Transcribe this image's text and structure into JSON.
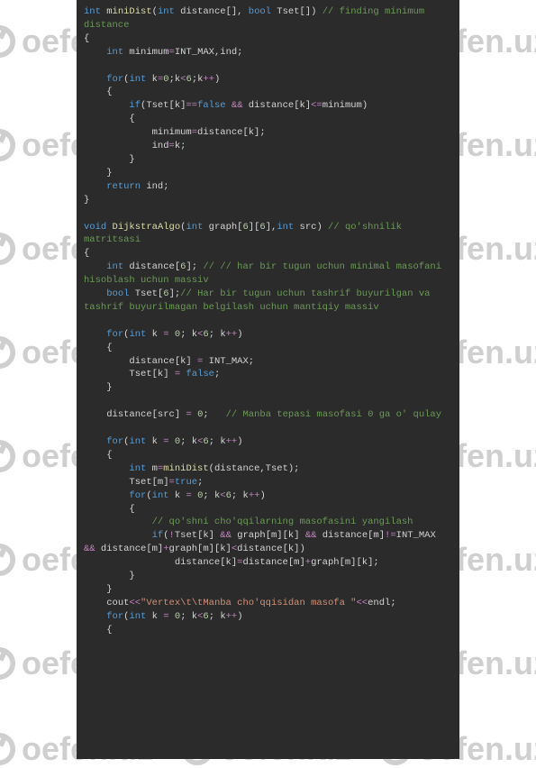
{
  "watermark": {
    "text": "oefen.uz"
  },
  "code": {
    "l01a": "int",
    "l01b": "miniDist",
    "l01c": "int",
    "l01d": " distance[], ",
    "l01e": "bool",
    "l01f": " Tset[]) ",
    "l01g": "// finding minimum distance",
    "l02": "{",
    "l03a": "    ",
    "l03b": "int",
    "l03c": " minimum",
    "l03d": "=",
    "l03e": "INT_MAX,ind;",
    "l04": "              ",
    "l05a": "    ",
    "l05b": "for",
    "l05c": "(",
    "l05d": "int",
    "l05e": " k",
    "l05f": "=",
    "l05g": "0",
    "l05h": ";k",
    "l05i": "<",
    "l05j": "6",
    "l05k": ";k",
    "l05l": "++",
    "l05m": ") ",
    "l06": "    {",
    "l07a": "        ",
    "l07b": "if",
    "l07c": "(Tset[k]",
    "l07d": "==",
    "l07e": "false",
    "l07f": " ",
    "l07g": "&&",
    "l07h": " distance[k]",
    "l07i": "<=",
    "l07j": "minimum)      ",
    "l08": "        {",
    "l09a": "            minimum",
    "l09b": "=",
    "l09c": "distance[k];",
    "l10a": "            ind",
    "l10b": "=",
    "l10c": "k;",
    "l11": "        }",
    "l12": "    }",
    "l13a": "    ",
    "l13b": "return",
    "l13c": " ind;",
    "l14": "}",
    "l15": "",
    "l16a": "void",
    "l16b": " ",
    "l16c": "DijkstraAlgo",
    "l16d": "(",
    "l16e": "int",
    "l16f": " graph[",
    "l16g": "6",
    "l16h": "][",
    "l16i": "6",
    "l16j": "],",
    "l16k": "int",
    "l16l": " src) ",
    "l16m": "// qo'shnilik matritsasi",
    "l17": "{",
    "l18a": "    ",
    "l18b": "int",
    "l18c": " distance[",
    "l18d": "6",
    "l18e": "]; ",
    "l18f": "// // har bir tugun uchun minimal masofani hisoblash uchun massiv                            ",
    "l19a": "    ",
    "l19b": "bool",
    "l19c": " Tset[",
    "l19d": "6",
    "l19e": "];",
    "l19f": "// Har bir tugun uchun tashrif buyurilgan va tashrif buyurilmagan belgilash uchun mantiqiy massiv",
    "l20": "     ",
    "l21a": "    ",
    "l21b": "for",
    "l21c": "(",
    "l21d": "int",
    "l21e": " k ",
    "l21f": "=",
    "l21g": " ",
    "l21h": "0",
    "l21i": "; k",
    "l21j": "<",
    "l21k": "6",
    "l21l": "; k",
    "l21m": "++",
    "l21n": ")",
    "l22": "    {",
    "l23a": "        distance[k] ",
    "l23b": "=",
    "l23c": " INT_MAX;",
    "l24a": "        Tset[k] ",
    "l24b": "=",
    "l24c": " ",
    "l24d": "false",
    "l24e": ";    ",
    "l25": "    }",
    "l26": "    ",
    "l27a": "    distance[src] ",
    "l27b": "=",
    "l27c": " ",
    "l27d": "0",
    "l27e": ";   ",
    "l27f": "// Manba tepasi masofasi 0 ga o' qulay               ",
    "l28": "    ",
    "l29a": "    ",
    "l29b": "for",
    "l29c": "(",
    "l29d": "int",
    "l29e": " k ",
    "l29f": "=",
    "l29g": " ",
    "l29h": "0",
    "l29i": "; k",
    "l29j": "<",
    "l29k": "6",
    "l29l": "; k",
    "l29m": "++",
    "l29n": ")                           ",
    "l30": "    {",
    "l31a": "        ",
    "l31b": "int",
    "l31c": " m",
    "l31d": "=",
    "l31e": "miniDist",
    "l31f": "(distance,Tset); ",
    "l32a": "        Tset[m]",
    "l32b": "=",
    "l32c": "true",
    "l32d": ";",
    "l33a": "        ",
    "l33b": "for",
    "l33c": "(",
    "l33d": "int",
    "l33e": " k ",
    "l33f": "=",
    "l33g": " ",
    "l33h": "0",
    "l33i": "; k",
    "l33j": "<",
    "l33k": "6",
    "l33l": "; k",
    "l33m": "++",
    "l33n": ")                  ",
    "l34": "        {",
    "l35": "            // qo'shni cho'qqilarning masofasini yangilash",
    "l36a": "            ",
    "l36b": "if",
    "l36c": "(",
    "l36d": "!",
    "l36e": "Tset[k] ",
    "l36f": "&&",
    "l36g": " graph[m][k] ",
    "l36h": "&&",
    "l36i": " distance[m]",
    "l36j": "!=",
    "l36k": "INT_MAX ",
    "l36l": "&&",
    "l36m": " distance[m]",
    "l36n": "+",
    "l36o": "graph[m][k]",
    "l36p": "<",
    "l36q": "distance[k])",
    "l37a": "                distance[k]",
    "l37b": "=",
    "l37c": "distance[m]",
    "l37d": "+",
    "l37e": "graph[m][k];",
    "l38": "        }",
    "l39": "    }",
    "l40a": "    cout",
    "l40b": "<<",
    "l40c": "\"Vertex\\t\\tManba cho'qqisidan masofa \"",
    "l40d": "<<",
    "l40e": "endl;",
    "l41a": "    ",
    "l41b": "for",
    "l41c": "(",
    "l41d": "int",
    "l41e": " k ",
    "l41f": "=",
    "l41g": " ",
    "l41h": "0",
    "l41i": "; k",
    "l41j": "<",
    "l41k": "6",
    "l41l": "; k",
    "l41m": "++",
    "l41n": ")                  ",
    "l42": "    { "
  }
}
